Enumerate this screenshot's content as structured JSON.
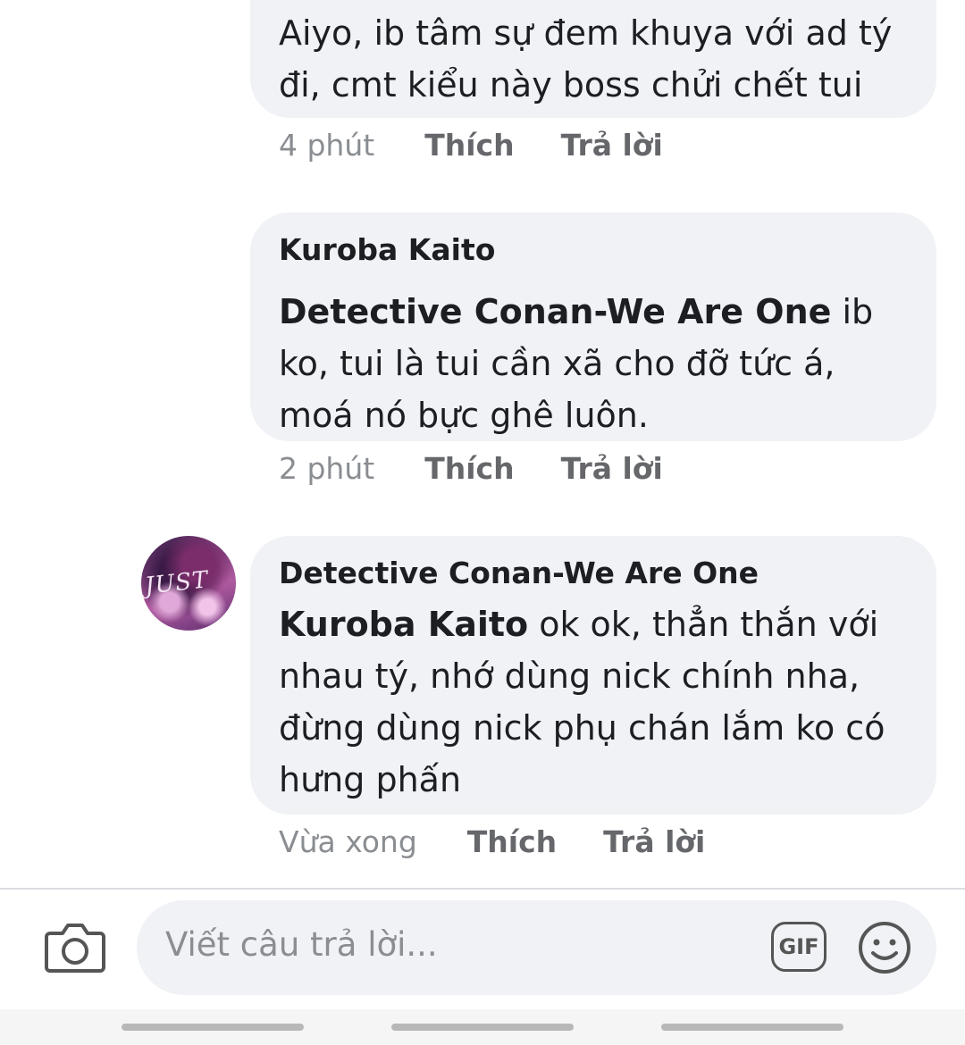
{
  "comments": [
    {
      "text": "Aiyo, ib tâm sự đem khuya với ad tý đi, cmt kiểu này boss chửi chết tui",
      "meta": {
        "time": "4 phút",
        "like": "Thích",
        "reply": "Trả lời"
      }
    },
    {
      "author": "Kuroba Kaito",
      "mention": "Detective Conan-We Are One",
      "text": " ib ko, tui là tui cần xã cho đỡ tức á, moá nó bực ghê luôn.",
      "meta": {
        "time": "2 phút",
        "like": "Thích",
        "reply": "Trả lời"
      }
    },
    {
      "author": "Detective Conan-We Are One",
      "avatar_text": "JUST",
      "mention": "Kuroba Kaito",
      "text": " ok ok, thẳn thắn với nhau tý, nhớ dùng nick chính nha, đừng dùng nick phụ chán lắm ko có hưng phấn",
      "meta": {
        "time": "Vừa xong",
        "like": "Thích",
        "reply": "Trả lời"
      }
    }
  ],
  "composer": {
    "placeholder": "Viết câu trả lời...",
    "gif_label": "GIF",
    "camera_icon": "camera-icon",
    "emoji_icon": "emoji-icon"
  }
}
